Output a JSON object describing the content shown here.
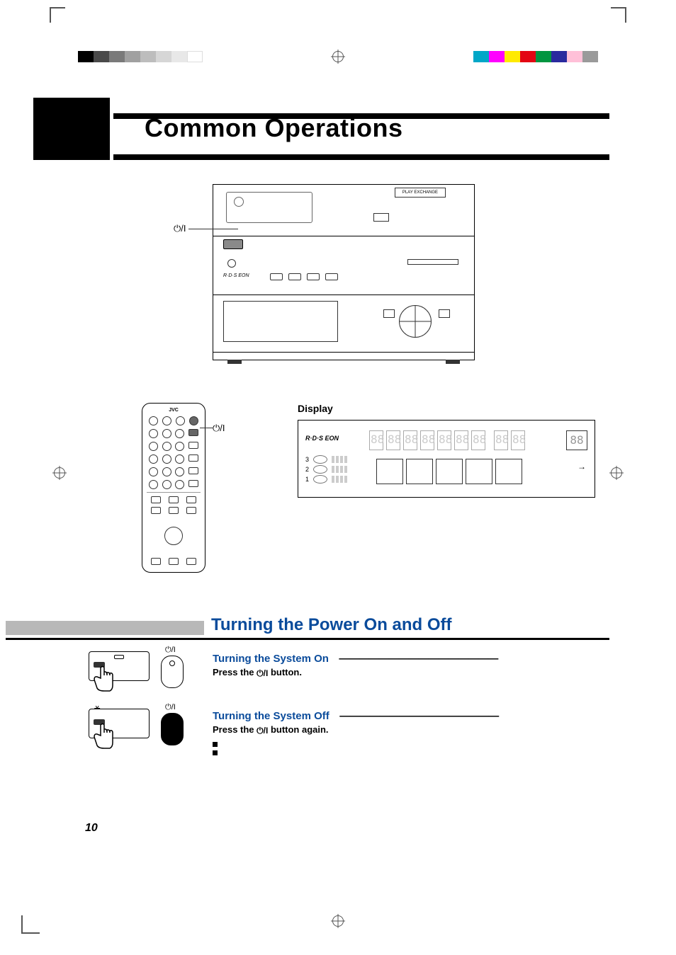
{
  "page_number": "10",
  "title": "Common Operations",
  "stereo": {
    "power_label_glyph": "⏻/I",
    "rds_eon": "R·D·S EON",
    "play_exchange": "PLAY EXCHANGE"
  },
  "remote": {
    "brand": "JVC",
    "power_label_glyph": "⏻/I"
  },
  "display": {
    "heading": "Display",
    "rds_eon": "R·D·S EON",
    "track_number_placeholder": "88",
    "disc_rows": [
      "3",
      "2",
      "1"
    ]
  },
  "section2": {
    "title": "Turning the Power On and Off",
    "turn_on": {
      "heading": "Turning the System On",
      "dash_line": "————————————————",
      "body_prefix": "Press the ",
      "glyph": "⏻/I",
      "body_suffix": " button."
    },
    "turn_off": {
      "heading": "Turning the System Off",
      "dash_line": "————————————————",
      "body_prefix": "Press the ",
      "glyph": "⏻/I",
      "body_suffix": " button again.",
      "remote_glyph": "⏻/I"
    }
  }
}
